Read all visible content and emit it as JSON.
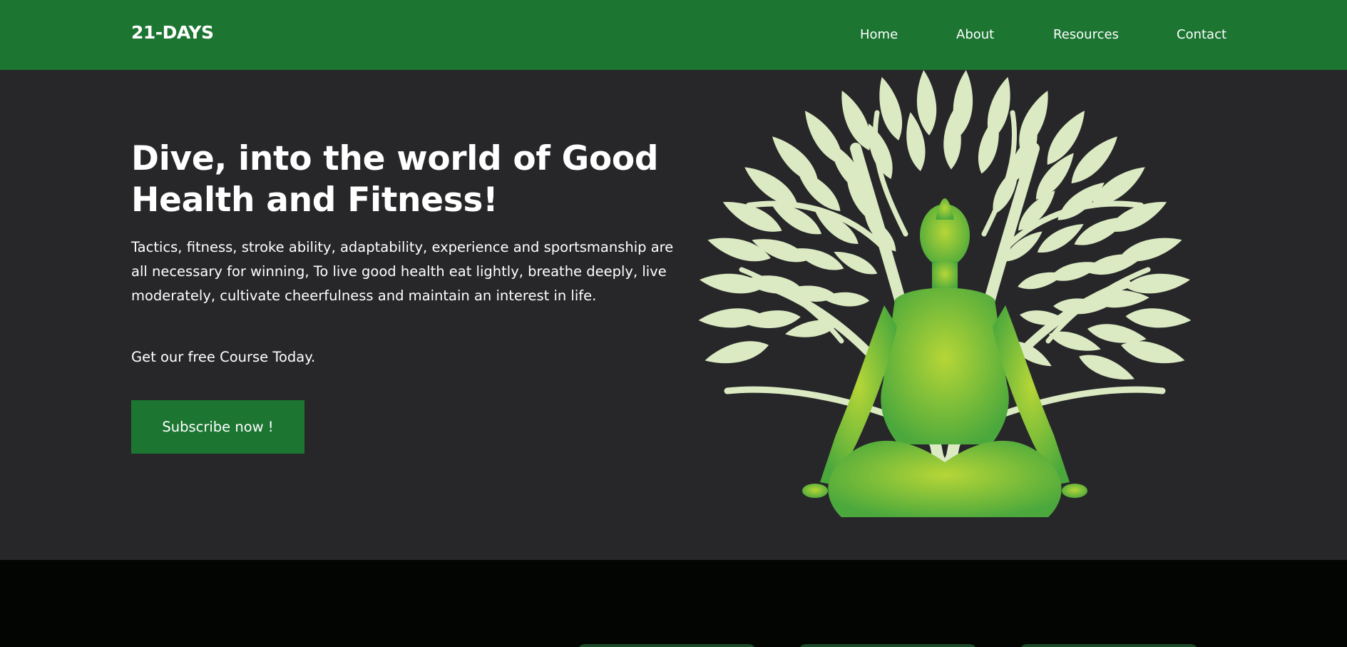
{
  "nav": {
    "brand": "21-DAYS",
    "links": [
      {
        "label": "Home"
      },
      {
        "label": "About"
      },
      {
        "label": "Resources"
      },
      {
        "label": "Contact"
      }
    ]
  },
  "hero": {
    "title": "Dive, into the world of Good Health and Fitness!",
    "description": "Tactics, fitness, stroke ability, adaptability, experience and sportsmanship are all necessary for winning, To live good health eat lightly, breathe deeply, live moderately, cultivate cheerfulness and maintain an interest in life.",
    "cta_text": "Get our free Course Today.",
    "button_label": "Subscribe now !",
    "illustration": "meditating-figure-tree-icon"
  },
  "colors": {
    "brand_green": "#1c7632",
    "hero_background": "#272729",
    "leaf": "#dbeac3",
    "figure_light": "#b6d637",
    "figure_dark": "#4aa83c",
    "footer_background": "#020502"
  }
}
